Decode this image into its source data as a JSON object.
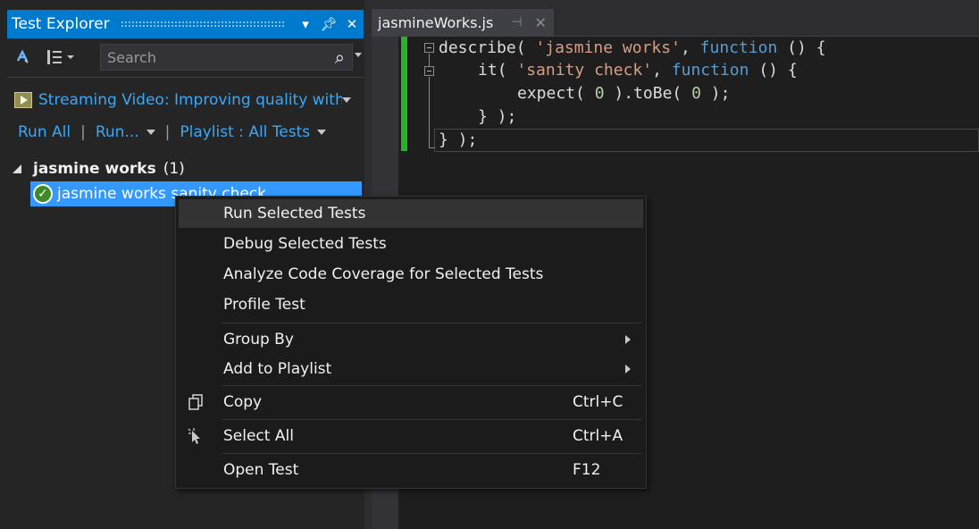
{
  "test_explorer": {
    "title": "Test Explorer",
    "search_placeholder": "Search",
    "stream_text": "Streaming Video: Improving quality with unit tests",
    "actions": {
      "run_all": "Run All",
      "run": "Run...",
      "playlist": "Playlist : All Tests",
      "separator": "|"
    },
    "group": {
      "name": "jasmine works",
      "count": "(1)"
    },
    "item": {
      "label": "jasmine works sanity check"
    }
  },
  "editor": {
    "tab": {
      "label": "jasmineWorks.js"
    },
    "code": {
      "l1_fn": "describe",
      "l1_p1": "( ",
      "l1_str": "'jasmine works'",
      "l1_p2": ", ",
      "l1_kw": "function",
      "l1_p3": " () {",
      "l2_fn": "it",
      "l2_p1": "( ",
      "l2_str": "'sanity check'",
      "l2_p2": ", ",
      "l2_kw": "function",
      "l2_p3": " () {",
      "l3_a": "expect( ",
      "l3_n1": "0",
      "l3_b": " ).toBe( ",
      "l3_n2": "0",
      "l3_c": " );",
      "l4": "} );",
      "l5": "} );"
    }
  },
  "context_menu": {
    "run_selected": "Run Selected Tests",
    "debug_selected": "Debug Selected Tests",
    "analyze_coverage": "Analyze Code Coverage for Selected Tests",
    "profile_test": "Profile Test",
    "group_by": "Group By",
    "add_to_playlist": "Add to Playlist",
    "copy": "Copy",
    "copy_shortcut": "Ctrl+C",
    "select_all": "Select All",
    "select_all_shortcut": "Ctrl+A",
    "open_test": "Open Test",
    "open_test_shortcut": "F12"
  },
  "colors": {
    "accent": "#007acc",
    "link": "#3ba7f5",
    "selection": "#3399ff",
    "pass": "#3c8b27",
    "change_bar": "#27b527"
  },
  "icons": [
    "dropdown-icon",
    "pin-icon",
    "close-icon",
    "run-tests-icon",
    "group-by-icon",
    "search-icon",
    "video-icon",
    "collapse-icon",
    "passed-icon",
    "copy-icon",
    "select-all-icon",
    "submenu-arrow-icon"
  ]
}
